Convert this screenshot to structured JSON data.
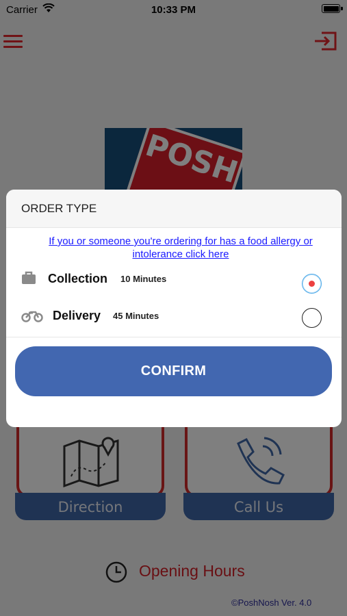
{
  "status_bar": {
    "carrier": "Carrier",
    "time": "10:33 PM"
  },
  "header": {
    "menu_icon": "hamburger-menu-icon",
    "logout_icon": "logout-icon",
    "accent_color": "#e0262d"
  },
  "logo": {
    "text": "POSH"
  },
  "tiles": {
    "direction_label": "Direction",
    "call_label": "Call Us"
  },
  "hours": {
    "label": "Opening Hours",
    "icon": "clock-icon"
  },
  "footer": {
    "text": "©PoshNosh Ver. 4.0"
  },
  "dialog": {
    "title": "ORDER TYPE",
    "allergy_link": "If you or someone you're ordering for has a food allergy or intolerance click here",
    "options": [
      {
        "name": "Collection",
        "eta": "10 Minutes",
        "icon": "briefcase-icon",
        "selected": true
      },
      {
        "name": "Delivery",
        "eta": "45 Minutes",
        "icon": "motorbike-icon",
        "selected": false
      }
    ],
    "confirm_label": "CONFIRM",
    "confirm_color": "#4267b0"
  }
}
